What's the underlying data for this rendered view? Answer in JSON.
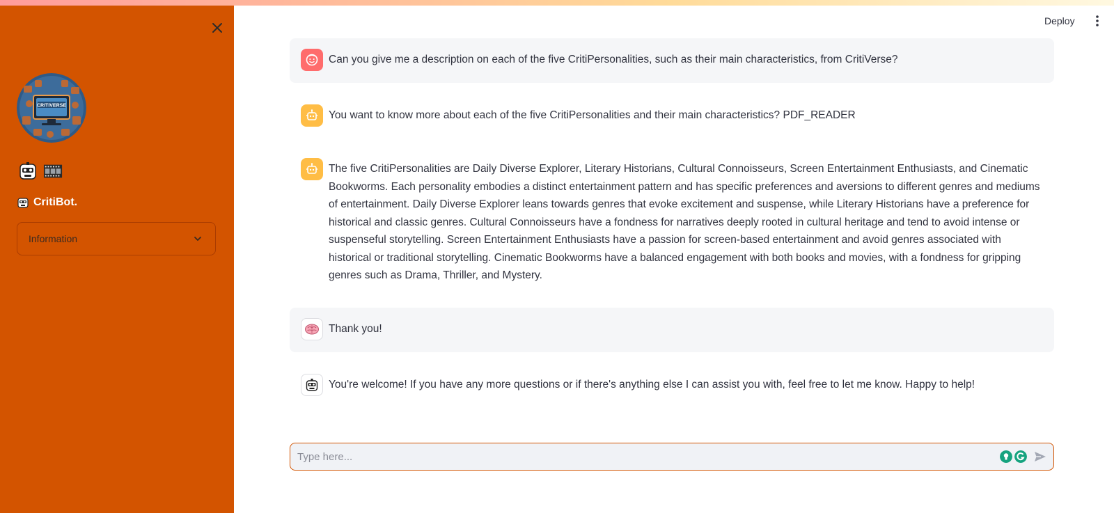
{
  "sidebar": {
    "close_icon": "close-icon",
    "logo_text": "CRITIVERSE",
    "icons": [
      "robot-face-icon",
      "film-frames-icon"
    ],
    "title": "CritiBot.",
    "expander": {
      "label": "Information",
      "icon": "chevron-down-icon",
      "expanded": false
    }
  },
  "header": {
    "deploy_label": "Deploy",
    "menu_icon": "kebab-menu-icon"
  },
  "messages": [
    {
      "role": "user",
      "avatar": "user-face-icon",
      "text": "Can you give me a description on each of the five CritiPersonalities, such as their main characteristics, from CritiVerse?"
    },
    {
      "role": "assistant",
      "avatar": "bot-icon",
      "text": "You want to know more about each of the five CritiPersonalities and their main characteristics? PDF_READER"
    },
    {
      "role": "assistant",
      "avatar": "bot-icon",
      "text": "The five CritiPersonalities are Daily Diverse Explorer, Literary Historians, Cultural Connoisseurs, Screen Entertainment Enthusiasts, and Cinematic Bookworms. Each personality embodies a distinct entertainment pattern and has specific preferences and aversions to different genres and mediums of entertainment. Daily Diverse Explorer leans towards genres that evoke excitement and suspense, while Literary Historians have a preference for historical and classic genres. Cultural Connoisseurs have a fondness for narratives deeply rooted in cultural heritage and tend to avoid intense or suspenseful storytelling. Screen Entertainment Enthusiasts have a passion for screen-based entertainment and avoid genres associated with historical or traditional storytelling. Cinematic Bookworms have a balanced engagement with both books and movies, with a fondness for gripping genres such as Drama, Thriller, and Mystery."
    },
    {
      "role": "user",
      "avatar": "brain-icon",
      "text": "Thank you!"
    },
    {
      "role": "assistant",
      "avatar": "robot-face-icon",
      "text": "You're welcome! If you have any more questions or if there's anything else I can assist you with, feel free to let me know. Happy to help!"
    }
  ],
  "input": {
    "placeholder": "Type here...",
    "value": "",
    "send_icon": "send-icon"
  },
  "colors": {
    "sidebar_bg": "#d35400",
    "accent": "#d35400",
    "user_avatar": "#ff6c6c",
    "bot_avatar": "#ffbd45",
    "message_bg": "#f5f6f8"
  }
}
